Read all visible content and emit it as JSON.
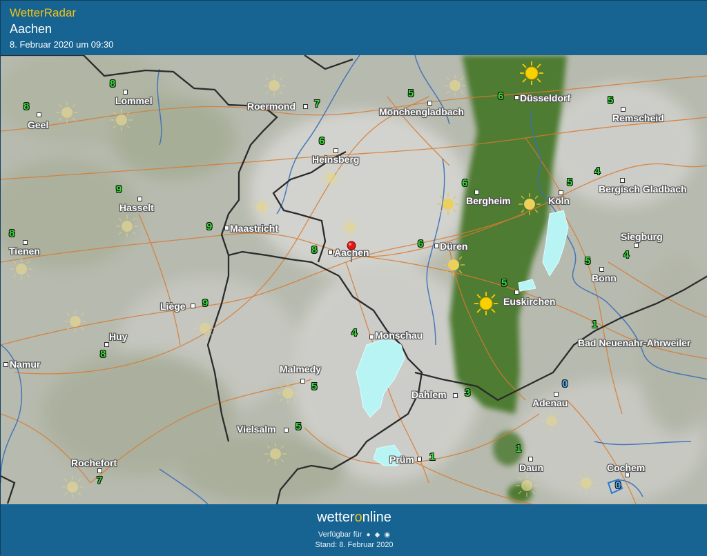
{
  "header": {
    "app_title": "WetterRadar",
    "place": "Aachen",
    "timestamp": "8. Februar 2020 um 09:30"
  },
  "map": {
    "cities": [
      {
        "name": "Lommel"
      },
      {
        "name": "Geel"
      },
      {
        "name": "Roermond"
      },
      {
        "name": "Mönchengladbach"
      },
      {
        "name": "Düsseldorf"
      },
      {
        "name": "Remscheid"
      },
      {
        "name": "Heinsberg"
      },
      {
        "name": "Hasselt"
      },
      {
        "name": "Maastricht"
      },
      {
        "name": "Bergheim"
      },
      {
        "name": "Köln"
      },
      {
        "name": "Bergisch Gladbach"
      },
      {
        "name": "Tienen"
      },
      {
        "name": "Aachen"
      },
      {
        "name": "Düren"
      },
      {
        "name": "Siegburg"
      },
      {
        "name": "Bonn"
      },
      {
        "name": "Liège"
      },
      {
        "name": "Euskirchen"
      },
      {
        "name": "Huy"
      },
      {
        "name": "Monschau"
      },
      {
        "name": "Bad Neuenahr-Ahrweiler"
      },
      {
        "name": "Namur"
      },
      {
        "name": "Malmedy"
      },
      {
        "name": "Dahlem"
      },
      {
        "name": "Adenau"
      },
      {
        "name": "Vielsalm"
      },
      {
        "name": "Prüm"
      },
      {
        "name": "Rochefort"
      },
      {
        "name": "Daun"
      },
      {
        "name": "Cochem"
      }
    ],
    "temperatures": [
      {
        "value": "8"
      },
      {
        "value": "8"
      },
      {
        "value": "7"
      },
      {
        "value": "5"
      },
      {
        "value": "6"
      },
      {
        "value": "5"
      },
      {
        "value": "6"
      },
      {
        "value": "9"
      },
      {
        "value": "9"
      },
      {
        "value": "6"
      },
      {
        "value": "5"
      },
      {
        "value": "4"
      },
      {
        "value": "8"
      },
      {
        "value": "8"
      },
      {
        "value": "6"
      },
      {
        "value": "4"
      },
      {
        "value": "5"
      },
      {
        "value": "9"
      },
      {
        "value": "5"
      },
      {
        "value": "8"
      },
      {
        "value": "4"
      },
      {
        "value": "1"
      },
      {
        "value": "5"
      },
      {
        "value": "3"
      },
      {
        "value": "0"
      },
      {
        "value": "5"
      },
      {
        "value": "1"
      },
      {
        "value": "7"
      },
      {
        "value": "1"
      },
      {
        "value": "0"
      }
    ],
    "location_marker_icon": "red-pin-icon",
    "weather_icon": "sun-icon",
    "colors": {
      "temp_warm": "#33dd33",
      "temp_cold": "#5ab4ff",
      "border": "#2b2b2b",
      "road": "#d87a30",
      "river": "#3a6fb8",
      "cloud_green": "#4d7a2e",
      "snow": "#b8f4f4"
    }
  },
  "footer": {
    "brand_part1": "wetter",
    "brand_o": "o",
    "brand_part2": "nline",
    "available_label": "Verfügbar für",
    "stand": "Stand: 8. Februar 2020"
  }
}
